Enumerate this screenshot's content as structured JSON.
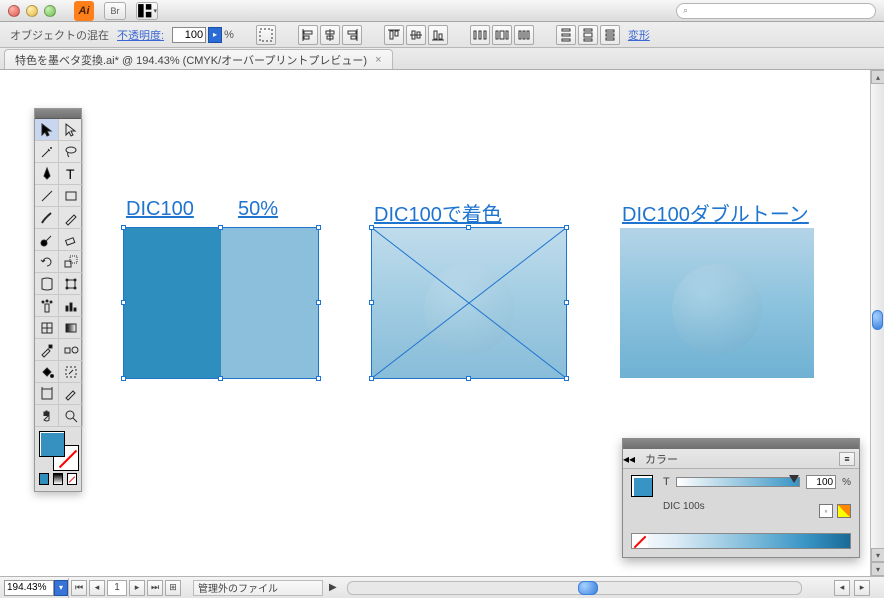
{
  "titlebar": {
    "br_label": "Br",
    "search_placeholder": "⌕"
  },
  "optionbar": {
    "blend_label": "オブジェクトの混在",
    "opacity_label": "不透明度:",
    "opacity_value": "100",
    "opacity_unit": "%",
    "transform_label": "変形"
  },
  "doctab": {
    "title": "特色を墨ベタ変換.ai* @ 194.43% (CMYK/オーバープリントプレビュー)",
    "close": "×"
  },
  "canvas": {
    "label1": "DIC100",
    "label2": "50%",
    "label3": "DIC100で着色",
    "label4": "DIC100ダブルトーン"
  },
  "color_panel": {
    "tab": "カラー",
    "channel_label": "T",
    "value": "100",
    "unit": "%",
    "swatch_name": "DIC 100s"
  },
  "bottom": {
    "zoom": "194.43%",
    "page": "1",
    "status": "管理外のファイル",
    "status_arrow": "▶"
  }
}
